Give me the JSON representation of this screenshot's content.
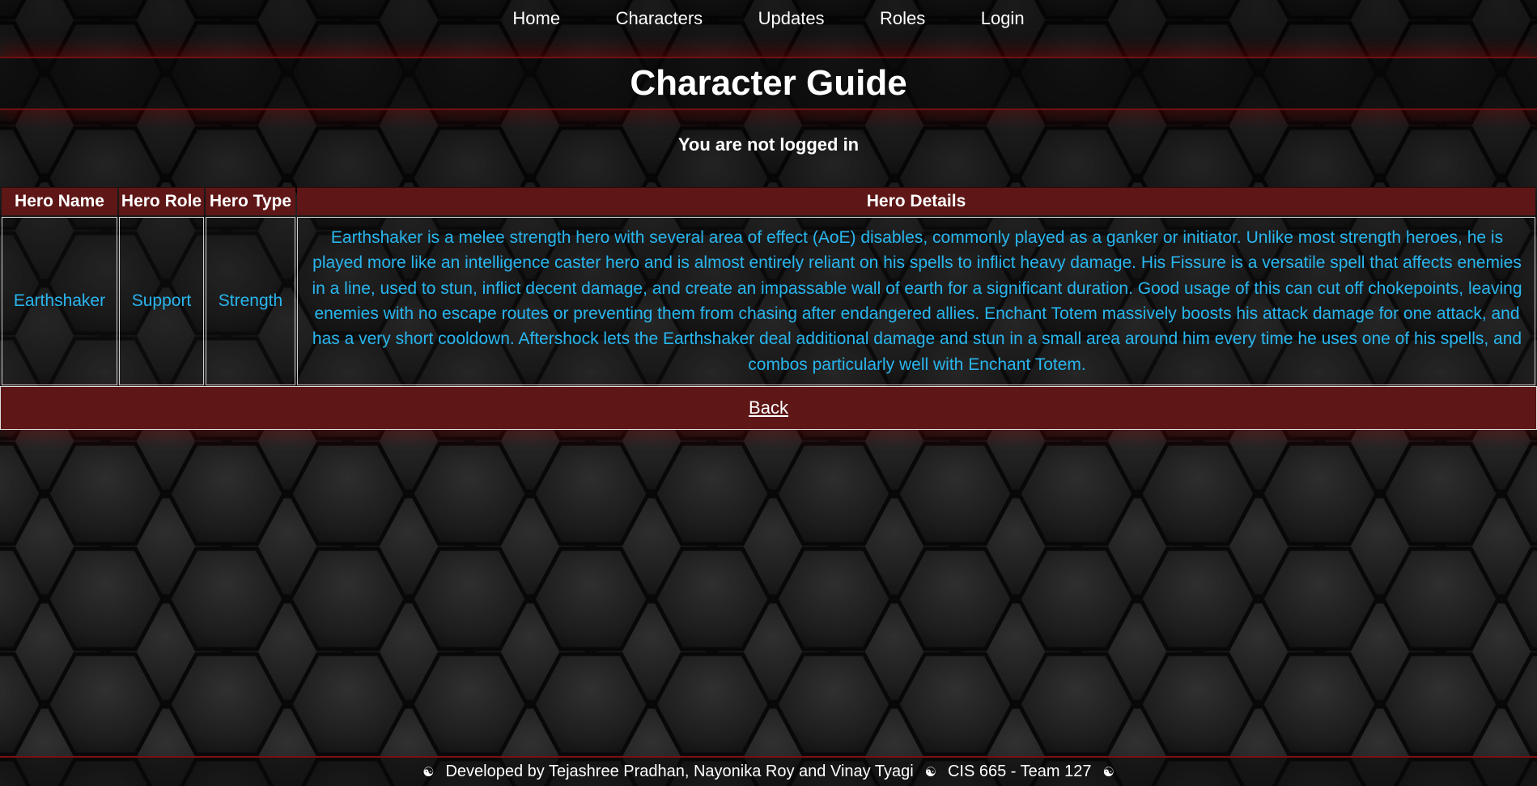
{
  "nav": {
    "items": [
      {
        "label": "Home"
      },
      {
        "label": "Characters"
      },
      {
        "label": "Updates"
      },
      {
        "label": "Roles"
      },
      {
        "label": "Login"
      }
    ]
  },
  "page": {
    "title": "Character Guide",
    "login_status": "You are not logged in"
  },
  "table": {
    "headers": [
      "Hero Name",
      "Hero Role",
      "Hero Type",
      "Hero Details"
    ],
    "rows": [
      {
        "name": "Earthshaker",
        "role": "Support",
        "type": "Strength",
        "details": "Earthshaker is a melee strength hero with several area of effect (AoE) disables, commonly played as a ganker or initiator. Unlike most strength heroes, he is played more like an intelligence caster hero and is almost entirely reliant on his spells to inflict heavy damage. His Fissure is a versatile spell that affects enemies in a line, used to stun, inflict decent damage, and create an impassable wall of earth for a significant duration. Good usage of this can cut off chokepoints, leaving enemies with no escape routes or preventing them from chasing after endangered allies. Enchant Totem massively boosts his attack damage for one attack, and has a very short cooldown. Aftershock lets the Earthshaker deal additional damage and stun in a small area around him every time he uses one of his spells, and combos particularly well with Enchant Totem."
      }
    ]
  },
  "back": {
    "label": "Back"
  },
  "footer": {
    "symbol": "☯",
    "developers": "Developed by Tejashree Pradhan, Nayonika Roy and Vinay Tyagi",
    "course": "CIS 665 - Team 127"
  },
  "colors": {
    "accent_red": "#5e1616",
    "link_blue": "#29b6ee",
    "background": "#1e1e1e"
  }
}
